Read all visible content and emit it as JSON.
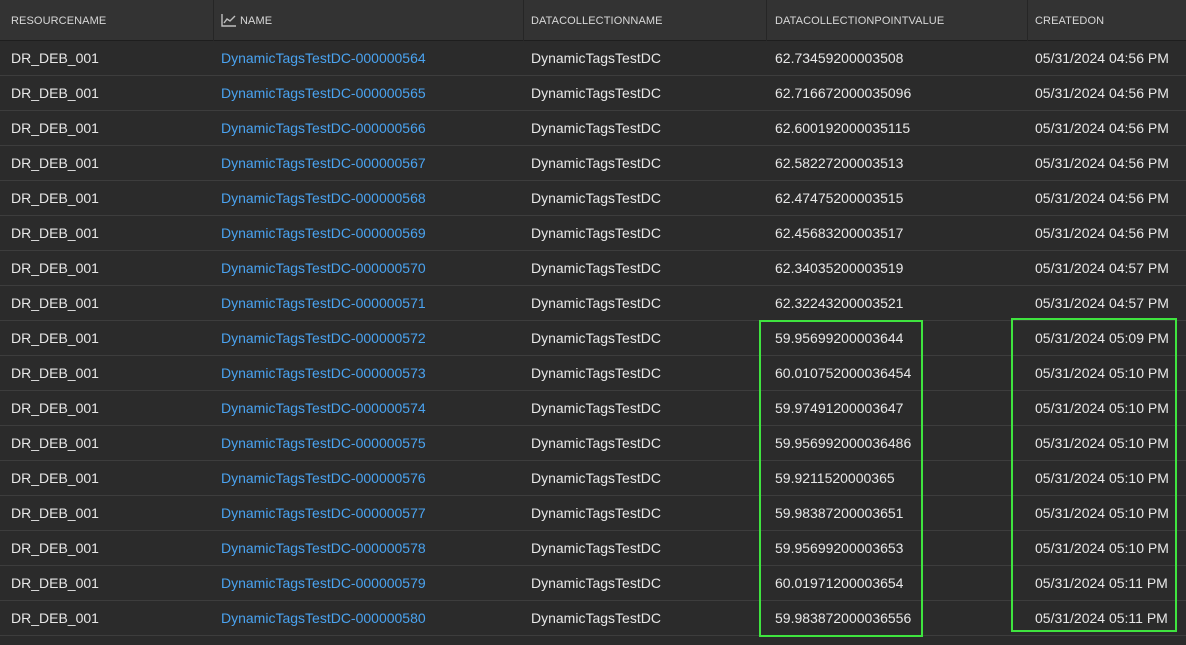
{
  "header": {
    "resourcename": "RESOURCENAME",
    "name": "NAME",
    "datacollectionname": "DATACOLLECTIONNAME",
    "datacollectionpointvalue": "DATACOLLECTIONPOINTVALUE",
    "createdon": "CREATEDON",
    "name_icon": "line-chart-icon"
  },
  "rows": [
    {
      "resourcename": "DR_DEB_001",
      "name": "DynamicTagsTestDC-000000564",
      "datacollectionname": "DynamicTagsTestDC",
      "value": "62.73459200003508",
      "createdon": "05/31/2024 04:56 PM"
    },
    {
      "resourcename": "DR_DEB_001",
      "name": "DynamicTagsTestDC-000000565",
      "datacollectionname": "DynamicTagsTestDC",
      "value": "62.716672000035096",
      "createdon": "05/31/2024 04:56 PM"
    },
    {
      "resourcename": "DR_DEB_001",
      "name": "DynamicTagsTestDC-000000566",
      "datacollectionname": "DynamicTagsTestDC",
      "value": "62.600192000035115",
      "createdon": "05/31/2024 04:56 PM"
    },
    {
      "resourcename": "DR_DEB_001",
      "name": "DynamicTagsTestDC-000000567",
      "datacollectionname": "DynamicTagsTestDC",
      "value": "62.58227200003513",
      "createdon": "05/31/2024 04:56 PM"
    },
    {
      "resourcename": "DR_DEB_001",
      "name": "DynamicTagsTestDC-000000568",
      "datacollectionname": "DynamicTagsTestDC",
      "value": "62.47475200003515",
      "createdon": "05/31/2024 04:56 PM"
    },
    {
      "resourcename": "DR_DEB_001",
      "name": "DynamicTagsTestDC-000000569",
      "datacollectionname": "DynamicTagsTestDC",
      "value": "62.45683200003517",
      "createdon": "05/31/2024 04:56 PM"
    },
    {
      "resourcename": "DR_DEB_001",
      "name": "DynamicTagsTestDC-000000570",
      "datacollectionname": "DynamicTagsTestDC",
      "value": "62.34035200003519",
      "createdon": "05/31/2024 04:57 PM"
    },
    {
      "resourcename": "DR_DEB_001",
      "name": "DynamicTagsTestDC-000000571",
      "datacollectionname": "DynamicTagsTestDC",
      "value": "62.32243200003521",
      "createdon": "05/31/2024 04:57 PM"
    },
    {
      "resourcename": "DR_DEB_001",
      "name": "DynamicTagsTestDC-000000572",
      "datacollectionname": "DynamicTagsTestDC",
      "value": "59.95699200003644",
      "createdon": "05/31/2024 05:09 PM"
    },
    {
      "resourcename": "DR_DEB_001",
      "name": "DynamicTagsTestDC-000000573",
      "datacollectionname": "DynamicTagsTestDC",
      "value": "60.010752000036454",
      "createdon": "05/31/2024 05:10 PM"
    },
    {
      "resourcename": "DR_DEB_001",
      "name": "DynamicTagsTestDC-000000574",
      "datacollectionname": "DynamicTagsTestDC",
      "value": "59.97491200003647",
      "createdon": "05/31/2024 05:10 PM"
    },
    {
      "resourcename": "DR_DEB_001",
      "name": "DynamicTagsTestDC-000000575",
      "datacollectionname": "DynamicTagsTestDC",
      "value": "59.956992000036486",
      "createdon": "05/31/2024 05:10 PM"
    },
    {
      "resourcename": "DR_DEB_001",
      "name": "DynamicTagsTestDC-000000576",
      "datacollectionname": "DynamicTagsTestDC",
      "value": "59.9211520000365",
      "createdon": "05/31/2024 05:10 PM"
    },
    {
      "resourcename": "DR_DEB_001",
      "name": "DynamicTagsTestDC-000000577",
      "datacollectionname": "DynamicTagsTestDC",
      "value": "59.98387200003651",
      "createdon": "05/31/2024 05:10 PM"
    },
    {
      "resourcename": "DR_DEB_001",
      "name": "DynamicTagsTestDC-000000578",
      "datacollectionname": "DynamicTagsTestDC",
      "value": "59.95699200003653",
      "createdon": "05/31/2024 05:10 PM"
    },
    {
      "resourcename": "DR_DEB_001",
      "name": "DynamicTagsTestDC-000000579",
      "datacollectionname": "DynamicTagsTestDC",
      "value": "60.01971200003654",
      "createdon": "05/31/2024 05:11 PM"
    },
    {
      "resourcename": "DR_DEB_001",
      "name": "DynamicTagsTestDC-000000580",
      "datacollectionname": "DynamicTagsTestDC",
      "value": "59.983872000036556",
      "createdon": "05/31/2024 05:11 PM"
    }
  ],
  "colors": {
    "background": "#2b2b2b",
    "header_background": "#333333",
    "link": "#4aa3f0",
    "text": "#e8e8e8",
    "highlight": "#3fe43f"
  }
}
